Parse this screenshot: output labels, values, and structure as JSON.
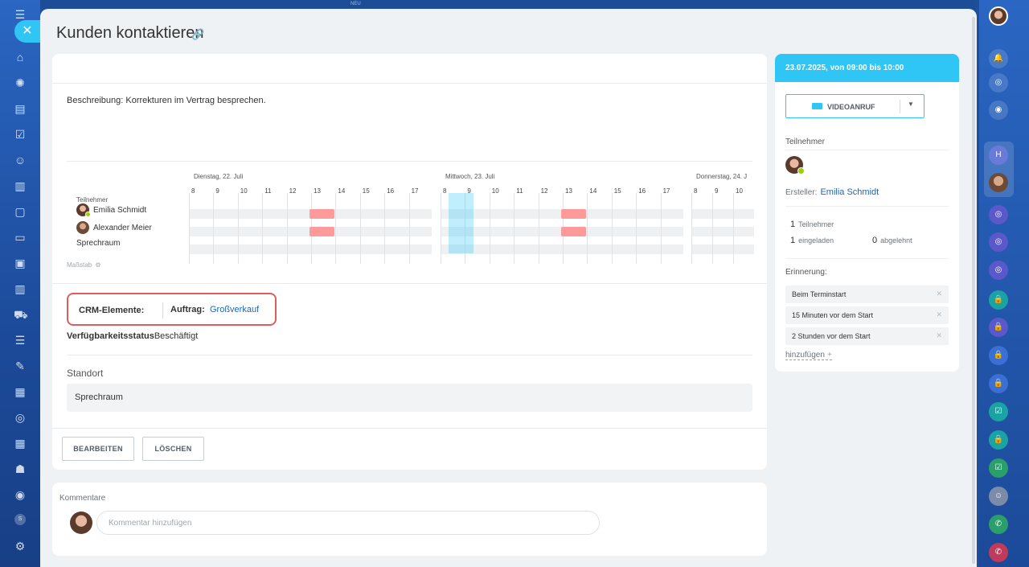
{
  "top": {
    "badge": "NEU"
  },
  "page": {
    "title": "Kunden kontaktieren"
  },
  "event": {
    "description": "Beschreibung: Korrekturen im Vertrag besprechen.",
    "timeline": {
      "participants_header": "Teilnehmer",
      "days": [
        "Dienstag, 22. Juli",
        "Mittwoch, 23. Juli",
        "Donnerstag, 24. J"
      ],
      "hours": [
        "8",
        "9",
        "10",
        "11",
        "12",
        "13",
        "14",
        "15",
        "16",
        "17"
      ],
      "hours_day3": [
        "8",
        "9",
        "10"
      ],
      "rows": [
        "Emilia Schmidt",
        "Alexander Meier",
        "Sprechraum"
      ],
      "scale_label": "Maßstab"
    },
    "crm": {
      "label": "CRM-Elemente:",
      "key": "Auftrag:",
      "value": "Großverkauf"
    },
    "availability": {
      "label": "Verfügbarkeitsstatus",
      "value": "Beschäftigt"
    },
    "location": {
      "label": "Standort",
      "value": "Sprechraum"
    },
    "buttons": {
      "edit": "BEARBEITEN",
      "delete": "LÖSCHEN"
    }
  },
  "comments": {
    "title": "Kommentare",
    "placeholder": "Kommentar hinzufügen"
  },
  "side": {
    "datetime": "23.07.2025, von 09:00 bis 10:00",
    "video_button": "VIDEOANRUF",
    "participants_label": "Teilnehmer",
    "creator_label": "Ersteller:",
    "creator_name": "Emilia Schmidt",
    "stats": {
      "participants_count": "1",
      "participants_label": "Teilnehmer",
      "invited_count": "1",
      "invited_label": "eingeladen",
      "declined_count": "0",
      "declined_label": "abgelehnt"
    },
    "reminder_label": "Erinnerung:",
    "reminders": [
      "Beim Terminstart",
      "15 Minuten vor dem Start",
      "2 Stunden vor dem Start"
    ],
    "add_label": "hinzufügen"
  },
  "left_bar": {
    "user_letter": "S"
  },
  "right_bar": {
    "letter": "H"
  },
  "colors": {
    "accent": "#2fc6f6",
    "link": "#2067b0",
    "busy": "#ff9a9a",
    "highlight": "#e05d5d",
    "online": "#9dcf00"
  },
  "icons": [
    "menu-icon",
    "close-icon",
    "home-icon",
    "settings-icon",
    "bell-icon",
    "video-camera-icon",
    "link-icon",
    "lock-icon",
    "phone-icon"
  ]
}
